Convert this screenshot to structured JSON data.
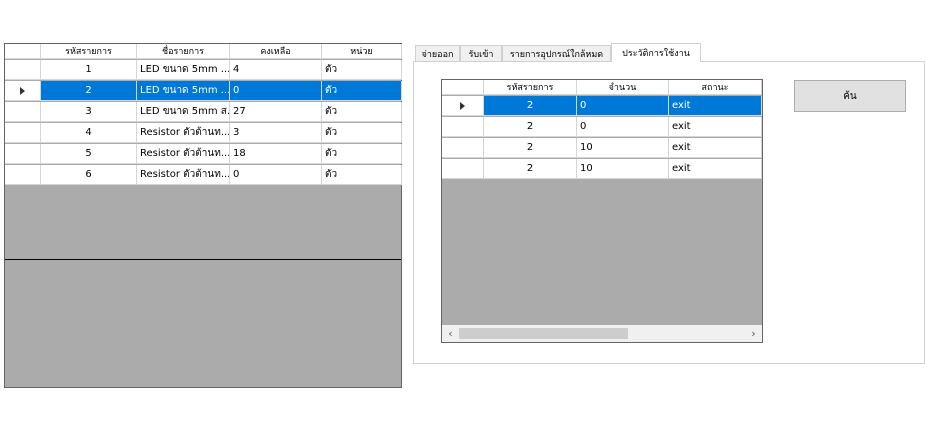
{
  "inventory_grid": {
    "columns": [
      "รหัสรายการ",
      "ชื่อรายการ",
      "คงเหลือ",
      "หน่วย"
    ],
    "rows": [
      [
        "1",
        "LED ขนาด 5mm ...",
        "4",
        "ตัว"
      ],
      [
        "2",
        "LED ขนาด 5mm ...",
        "0",
        "ตัว"
      ],
      [
        "3",
        "LED ขนาด 5mm ส...",
        "27",
        "ตัว"
      ],
      [
        "4",
        "Resistor ตัวต้านท...",
        "3",
        "ตัว"
      ],
      [
        "5",
        "Resistor ตัวต้านท...",
        "18",
        "ตัว"
      ],
      [
        "6",
        "Resistor ตัวต้านท...",
        "0",
        "ตัว"
      ]
    ],
    "selected_row": 2
  },
  "tabs": [
    "จ่ายออก",
    "รับเข้า",
    "รายการอุปกรณ์ใกล้หมด",
    "ประวัติการใช้งาน"
  ],
  "active_tab": "ประวัติการใช้งาน",
  "history_grid": {
    "columns": [
      "รหัสรายการ",
      "จำนวน",
      "สถานะ"
    ],
    "rows": [
      [
        "2",
        "0",
        "exit"
      ],
      [
        "2",
        "0",
        "exit"
      ],
      [
        "2",
        "10",
        "exit"
      ],
      [
        "2",
        "10",
        "exit"
      ]
    ],
    "selected_row": 1
  },
  "search_button_label": "ค้น",
  "colors": {
    "selection": "#0078d7",
    "grid_background": "#ababab"
  }
}
